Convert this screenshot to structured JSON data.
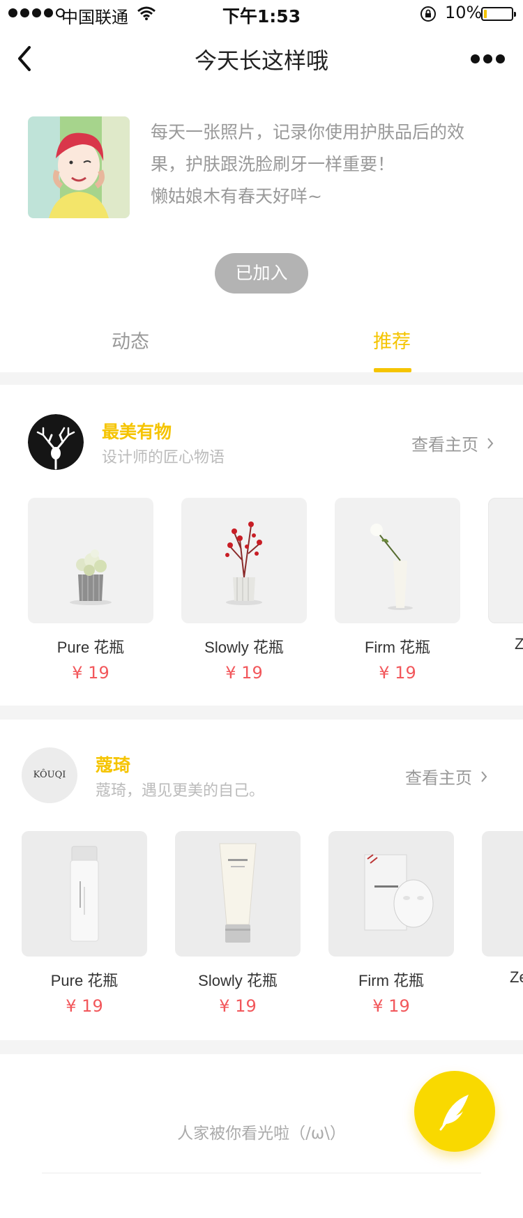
{
  "status_bar": {
    "carrier": "中国联通",
    "time": "下午1:53",
    "battery": "10%",
    "battery_level": 0.1
  },
  "nav": {
    "title": "今天长这样哦"
  },
  "intro": {
    "text_line1": "每天一张照片，记录你使用护肤品后的效",
    "text_line2": "果，护肤跟洗脸刷牙一样重要！",
    "text_line3": "懒姑娘木有春天好咩~",
    "joined_label": "已加入"
  },
  "tabs": [
    {
      "label": "动态",
      "active": false
    },
    {
      "label": "推荐",
      "active": true
    }
  ],
  "shops": [
    {
      "name": "最美有物",
      "subtitle": "设计师的匠心物语",
      "link_label": "查看主页",
      "products": [
        {
          "name": "Pure 花瓶",
          "price": "¥ 19"
        },
        {
          "name": "Slowly 花瓶",
          "price": "¥ 19"
        },
        {
          "name": "Firm 花瓶",
          "price": "¥ 19"
        },
        {
          "name": "Z",
          "price": ""
        }
      ]
    },
    {
      "name": "蔻琦",
      "subtitle": "蔻琦，遇见更美的自己。",
      "link_label": "查看主页",
      "logo_text": "KÔUQI",
      "products": [
        {
          "name": "Pure 花瓶",
          "price": "¥ 19"
        },
        {
          "name": "Slowly 花瓶",
          "price": "¥ 19"
        },
        {
          "name": "Firm 花瓶",
          "price": "¥ 19"
        },
        {
          "name": "Ze",
          "price": ""
        }
      ]
    }
  ],
  "footer": {
    "text": "人家被你看光啦（/ω\\）"
  },
  "colors": {
    "accent": "#f5c400",
    "price": "#f2575b",
    "fab": "#f9d900"
  },
  "icons": {
    "back": "back-arrow-icon",
    "more": "more-dots-icon",
    "chevron": "chevron-right-icon",
    "fab": "feather-pen-icon"
  }
}
